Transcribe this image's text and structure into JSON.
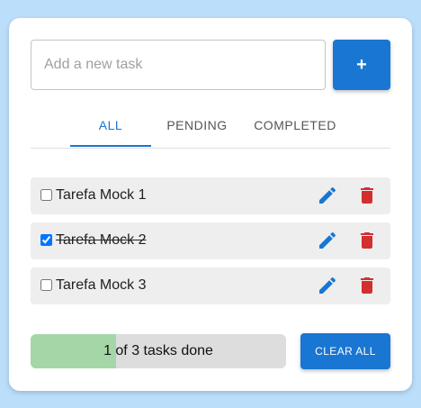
{
  "new_task": {
    "placeholder": "Add a new task",
    "value": "",
    "add_label": "+"
  },
  "tabs": [
    {
      "label": "ALL",
      "active": true
    },
    {
      "label": "PENDING",
      "active": false
    },
    {
      "label": "COMPLETED",
      "active": false
    }
  ],
  "tasks": [
    {
      "label": "Tarefa Mock 1",
      "completed": false
    },
    {
      "label": "Tarefa Mock 2",
      "completed": true
    },
    {
      "label": "Tarefa Mock 3",
      "completed": false
    }
  ],
  "icons": {
    "edit": "pencil-icon",
    "delete": "trash-icon"
  },
  "footer": {
    "progress_text": "1 of 3 tasks done",
    "progress_fraction": 0.333,
    "clear_label": "CLEAR ALL"
  },
  "colors": {
    "background": "#bbdefb",
    "primary": "#1976d2",
    "delete": "#d32f2f",
    "progress_fill": "#a5d6a7",
    "progress_track": "#dddddd",
    "task_bg": "#eeeeee"
  }
}
